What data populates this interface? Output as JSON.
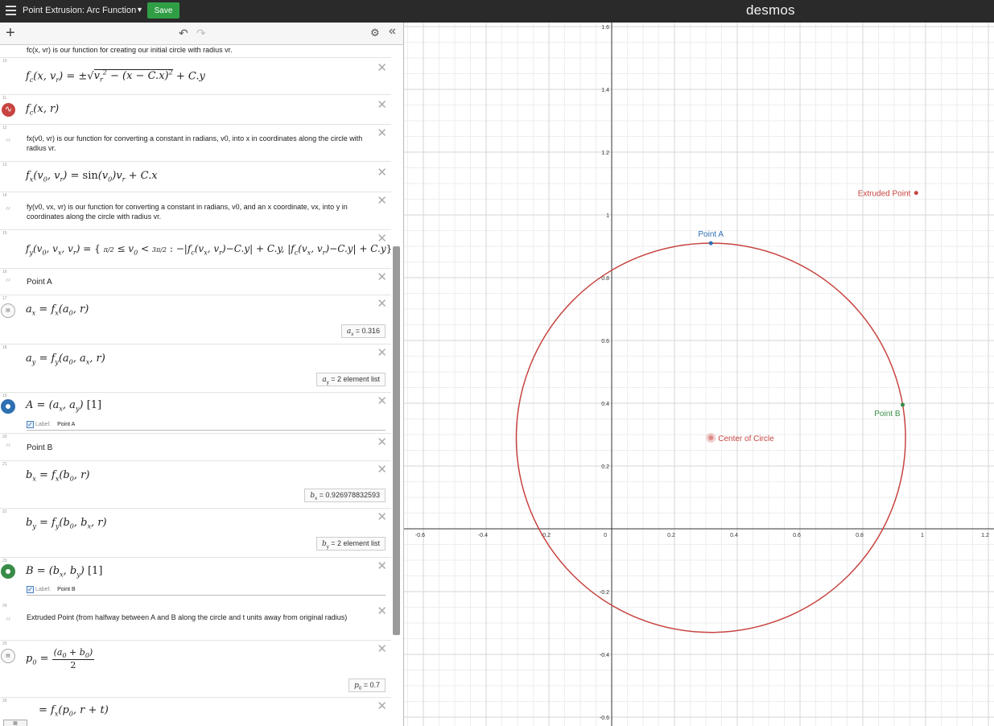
{
  "topbar": {
    "title": "Point Extrusion: Arc Function",
    "save_label": "Save",
    "brand": "desmos"
  },
  "exp_header": {
    "icons": [
      "plus-icon",
      "undo-icon",
      "redo-icon",
      "gear-icon",
      "collapse-icon"
    ]
  },
  "expressions": {
    "partial_top": "fc(x, vr) is our function for creating our initial circle with radius vr.",
    "e10_num": "10",
    "e11_num": "11",
    "e12_num": "12",
    "e12_text": "fx(v0, vr) is our function for converting a constant in radians, v0, into x in coordinates along the circle with radius vr.",
    "e13_num": "13",
    "e14_num": "14",
    "e14_text": "fy(v0, vx, vr) is our function for converting a constant in radians, v0, and an x coordinate, vx, into y in coordinates along the circle with radius vr.",
    "e15_num": "15",
    "e16_num": "16",
    "e16_text": "Point A",
    "e17_num": "17",
    "e17_eval_label": "a",
    "e17_eval_sub": "x",
    "e17_eval_value": "= 0.316",
    "e18_num": "18",
    "e18_eval_label": "a",
    "e18_eval_sub": "y",
    "e18_eval_value": "= 2 element list",
    "e19_num": "19",
    "e19_label_caption": "Label:",
    "e19_label_value": "Point A",
    "e20_num": "20",
    "e20_text": "Point B",
    "e21_num": "21",
    "e21_eval_label": "b",
    "e21_eval_sub": "x",
    "e21_eval_value": "= 0.926978832593",
    "e22_num": "22",
    "e22_eval_label": "b",
    "e22_eval_sub": "y",
    "e22_eval_value": "= 2 element list",
    "e23_num": "23",
    "e23_label_caption": "Label:",
    "e23_label_value": "Point B",
    "e24_num": "24",
    "e24_text": "Extruded Point (from halfway between A and B along the circle and t units away from original radius)",
    "e25_num": "25",
    "e25_eval_label": "p",
    "e25_eval_sub": "0",
    "e25_eval_value": "= 0.7",
    "e26_num": "26",
    "keypad_label": "▦"
  },
  "graph": {
    "x_ticks": [
      "-0.6",
      "-0.4",
      "-0.2",
      "0",
      "0.2",
      "0.4",
      "0.6",
      "0.8",
      "1",
      "1.2"
    ],
    "y_ticks": [
      "1.6",
      "1.4",
      "1.2",
      "1",
      "0.8",
      "0.6",
      "0.4",
      "0.2",
      "-0.2",
      "-0.4",
      "-0.6"
    ],
    "points": [
      {
        "name": "Point A",
        "x": 0.316,
        "y": 0.91,
        "color": "#2d70b3"
      },
      {
        "name": "Point B",
        "x": 0.927,
        "y": 0.395,
        "color": "#388c46"
      },
      {
        "name": "Center of Circle",
        "x": 0.316,
        "y": 0.29,
        "color": "#c74440"
      },
      {
        "name": "Extruded Point",
        "x": 0.97,
        "y": 1.07,
        "color": "#c74440"
      }
    ],
    "circle": {
      "cx": 0.316,
      "cy": 0.29,
      "r": 0.62,
      "color": "#c74440"
    }
  }
}
